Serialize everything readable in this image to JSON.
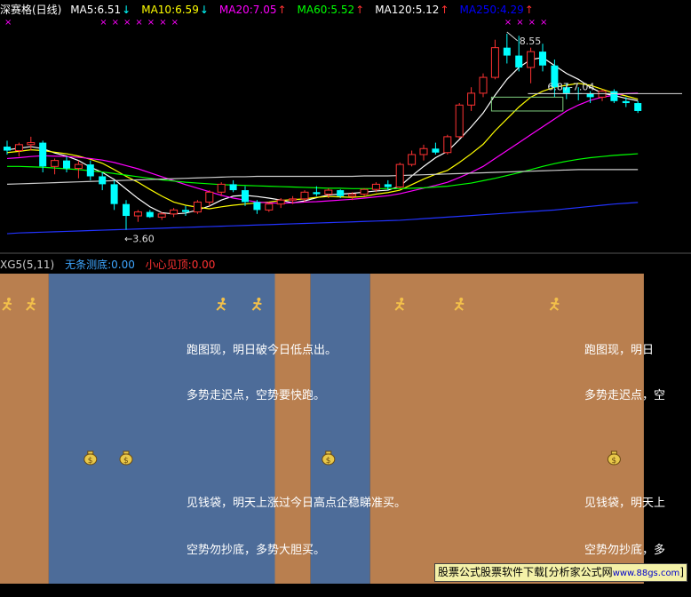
{
  "header": {
    "title": "深赛格(日线)",
    "ma": [
      {
        "label": "MA5:6.51",
        "arrow": "↓",
        "color": "#ffffff"
      },
      {
        "label": "MA10:6.59",
        "arrow": "↓",
        "color": "#ffff00"
      },
      {
        "label": "MA20:7.05",
        "arrow": "↑",
        "color": "#ff00ff"
      },
      {
        "label": "MA60:5.52",
        "arrow": "↑",
        "color": "#00ff00"
      },
      {
        "label": "MA120:5.12",
        "arrow": "↑",
        "color": "#ffffff"
      },
      {
        "label": "MA250:4.29",
        "arrow": "↑",
        "color": "#0000ff"
      }
    ]
  },
  "sub_header": {
    "name": "XG5(5,11)",
    "item1": "无条测底:0.00",
    "item2": "小心见顶:0.00"
  },
  "colors": {
    "up": "#ff3232",
    "down": "#00ffff",
    "orange_bg": "#b97f4f",
    "blue_bg": "#4d6c99",
    "marker": "#ff00ff",
    "runner": "#f3c04a"
  },
  "signal_texts": {
    "run": "跑图现，明日破今日低点出。",
    "run_short": "跑图现，明日",
    "multi_late": "多势走迟点，空势要快跑。",
    "multi_late_short": "多势走迟点，空",
    "money": "见钱袋，明天上涨过今日高点企稳睇准买。",
    "money_short": "见钱袋，明天上",
    "empty_bottom": "空势勿抄底，多势大胆买。",
    "empty_bottom_short": "空势勿抄底，多"
  },
  "watermark": {
    "text": "股票公式股票软件下载[分析家公式网",
    "url": "www.88gs.com",
    "end": "]"
  },
  "chart_data": {
    "type": "candlestick",
    "ylim": [
      3.3,
      9.0
    ],
    "annotations": [
      {
        "text": "8.55",
        "bar": 42,
        "price": 8.55
      },
      {
        "text": "3.60",
        "bar": 10,
        "price": 3.6
      },
      {
        "text": "6.87-7.04",
        "bar": 46,
        "price": 7.04
      }
    ],
    "candles": [
      [
        5.7,
        5.85,
        5.5,
        5.6
      ],
      [
        5.6,
        5.8,
        5.45,
        5.75
      ],
      [
        5.75,
        5.95,
        5.6,
        5.8
      ],
      [
        5.8,
        5.85,
        5.05,
        5.2
      ],
      [
        5.2,
        5.4,
        5.0,
        5.35
      ],
      [
        5.35,
        5.45,
        5.05,
        5.15
      ],
      [
        5.15,
        5.35,
        4.9,
        5.25
      ],
      [
        5.25,
        5.35,
        4.85,
        4.95
      ],
      [
        4.95,
        5.05,
        4.6,
        4.75
      ],
      [
        4.75,
        4.85,
        4.1,
        4.25
      ],
      [
        4.25,
        4.35,
        3.6,
        3.95
      ],
      [
        3.95,
        4.1,
        3.8,
        4.05
      ],
      [
        4.05,
        4.1,
        3.9,
        3.92
      ],
      [
        3.92,
        4.05,
        3.85,
        4.0
      ],
      [
        4.0,
        4.15,
        3.92,
        4.1
      ],
      [
        4.1,
        4.2,
        3.95,
        4.05
      ],
      [
        4.05,
        4.35,
        4.0,
        4.3
      ],
      [
        4.3,
        4.6,
        4.2,
        4.55
      ],
      [
        4.55,
        4.8,
        4.45,
        4.75
      ],
      [
        4.75,
        4.85,
        4.55,
        4.6
      ],
      [
        4.6,
        4.7,
        4.2,
        4.3
      ],
      [
        4.3,
        4.35,
        4.0,
        4.1
      ],
      [
        4.1,
        4.3,
        4.05,
        4.25
      ],
      [
        4.25,
        4.4,
        4.15,
        4.35
      ],
      [
        4.35,
        4.45,
        4.25,
        4.38
      ],
      [
        4.38,
        4.6,
        4.3,
        4.55
      ],
      [
        4.55,
        4.7,
        4.45,
        4.5
      ],
      [
        4.5,
        4.65,
        4.4,
        4.6
      ],
      [
        4.6,
        4.62,
        4.4,
        4.45
      ],
      [
        4.45,
        4.55,
        4.35,
        4.5
      ],
      [
        4.5,
        4.65,
        4.45,
        4.62
      ],
      [
        4.62,
        4.8,
        4.55,
        4.75
      ],
      [
        4.75,
        4.85,
        4.6,
        4.68
      ],
      [
        4.68,
        5.3,
        4.65,
        5.25
      ],
      [
        5.25,
        5.6,
        5.2,
        5.5
      ],
      [
        5.5,
        5.75,
        5.35,
        5.65
      ],
      [
        5.65,
        5.8,
        5.5,
        5.55
      ],
      [
        5.55,
        6.0,
        5.5,
        5.95
      ],
      [
        5.95,
        6.8,
        5.9,
        6.75
      ],
      [
        6.75,
        7.2,
        6.6,
        7.05
      ],
      [
        7.05,
        7.55,
        6.95,
        7.45
      ],
      [
        7.45,
        8.4,
        7.4,
        8.2
      ],
      [
        8.2,
        8.55,
        7.8,
        8.0
      ],
      [
        8.0,
        8.5,
        7.6,
        7.7
      ],
      [
        7.7,
        8.2,
        7.3,
        8.1
      ],
      [
        8.1,
        8.3,
        7.6,
        7.75
      ],
      [
        7.75,
        7.9,
        6.95,
        7.2
      ],
      [
        7.2,
        7.3,
        6.9,
        7.05
      ],
      [
        7.05,
        7.2,
        6.87,
        7.04
      ],
      [
        7.04,
        7.1,
        6.8,
        6.95
      ],
      [
        6.95,
        7.15,
        6.85,
        7.1
      ],
      [
        7.1,
        7.15,
        6.8,
        6.85
      ],
      [
        6.85,
        6.95,
        6.7,
        6.8
      ],
      [
        6.8,
        6.85,
        6.55,
        6.6
      ]
    ],
    "ma_series": [
      {
        "name": "MA5",
        "color": "#ffffff",
        "values": [
          5.62,
          5.66,
          5.7,
          5.65,
          5.54,
          5.46,
          5.35,
          5.18,
          5.05,
          4.87,
          4.63,
          4.39,
          4.18,
          4.03,
          4.0,
          4.02,
          4.1,
          4.2,
          4.35,
          4.45,
          4.47,
          4.44,
          4.4,
          4.35,
          4.28,
          4.33,
          4.41,
          4.48,
          4.5,
          4.52,
          4.55,
          4.58,
          4.6,
          4.7,
          4.96,
          5.2,
          5.42,
          5.58,
          5.88,
          6.2,
          6.55,
          7.0,
          7.4,
          7.7,
          7.9,
          7.95,
          7.75,
          7.55,
          7.4,
          7.2,
          7.05,
          6.99,
          6.92,
          6.86
        ]
      },
      {
        "name": "MA10",
        "color": "#ffff00",
        "values": [
          5.55,
          5.58,
          5.62,
          5.6,
          5.56,
          5.52,
          5.46,
          5.38,
          5.28,
          5.12,
          4.95,
          4.8,
          4.62,
          4.45,
          4.3,
          4.22,
          4.17,
          4.13,
          4.18,
          4.22,
          4.25,
          4.28,
          4.3,
          4.34,
          4.36,
          4.38,
          4.42,
          4.44,
          4.43,
          4.42,
          4.44,
          4.5,
          4.54,
          4.6,
          4.74,
          4.88,
          5.0,
          5.1,
          5.3,
          5.52,
          5.76,
          6.1,
          6.4,
          6.7,
          6.95,
          7.1,
          7.2,
          7.25,
          7.3,
          7.25,
          7.15,
          7.05,
          6.98,
          6.9
        ]
      },
      {
        "name": "MA20",
        "color": "#ff00ff",
        "values": [
          5.4,
          5.42,
          5.45,
          5.47,
          5.46,
          5.45,
          5.43,
          5.4,
          5.36,
          5.3,
          5.22,
          5.14,
          5.04,
          4.94,
          4.84,
          4.74,
          4.65,
          4.56,
          4.47,
          4.4,
          4.35,
          4.3,
          4.28,
          4.27,
          4.28,
          4.3,
          4.31,
          4.33,
          4.35,
          4.37,
          4.4,
          4.43,
          4.46,
          4.51,
          4.58,
          4.65,
          4.72,
          4.8,
          4.92,
          5.05,
          5.2,
          5.4,
          5.6,
          5.8,
          6.0,
          6.2,
          6.4,
          6.6,
          6.75,
          6.87,
          6.95,
          7.0,
          7.04,
          7.05
        ]
      },
      {
        "name": "MA60",
        "color": "#00ff00",
        "values": [
          5.2,
          5.2,
          5.19,
          5.18,
          5.16,
          5.14,
          5.12,
          5.09,
          5.06,
          5.02,
          4.98,
          4.94,
          4.9,
          4.86,
          4.83,
          4.8,
          4.78,
          4.76,
          4.74,
          4.73,
          4.72,
          4.71,
          4.7,
          4.69,
          4.68,
          4.67,
          4.66,
          4.65,
          4.65,
          4.64,
          4.64,
          4.64,
          4.64,
          4.64,
          4.65,
          4.66,
          4.68,
          4.7,
          4.74,
          4.78,
          4.84,
          4.9,
          4.97,
          5.04,
          5.12,
          5.2,
          5.27,
          5.33,
          5.38,
          5.42,
          5.45,
          5.48,
          5.5,
          5.52
        ]
      },
      {
        "name": "MA120",
        "color": "#cccccc",
        "values": [
          4.75,
          4.76,
          4.77,
          4.78,
          4.79,
          4.8,
          4.81,
          4.82,
          4.83,
          4.84,
          4.85,
          4.86,
          4.87,
          4.88,
          4.89,
          4.9,
          4.91,
          4.92,
          4.93,
          4.94,
          4.94,
          4.95,
          4.95,
          4.95,
          4.95,
          4.95,
          4.95,
          4.95,
          4.95,
          4.95,
          4.96,
          4.96,
          4.96,
          4.97,
          4.98,
          4.99,
          5.0,
          5.01,
          5.02,
          5.03,
          5.04,
          5.05,
          5.06,
          5.07,
          5.08,
          5.09,
          5.1,
          5.11,
          5.12,
          5.12,
          5.12,
          5.12,
          5.12,
          5.12
        ]
      },
      {
        "name": "MA250",
        "color": "#2233ff",
        "values": [
          3.5,
          3.52,
          3.53,
          3.54,
          3.55,
          3.56,
          3.57,
          3.58,
          3.59,
          3.6,
          3.61,
          3.62,
          3.63,
          3.64,
          3.65,
          3.66,
          3.67,
          3.68,
          3.69,
          3.7,
          3.71,
          3.72,
          3.73,
          3.74,
          3.75,
          3.76,
          3.77,
          3.78,
          3.79,
          3.8,
          3.81,
          3.82,
          3.83,
          3.84,
          3.86,
          3.88,
          3.9,
          3.92,
          3.94,
          3.96,
          3.98,
          4.0,
          4.02,
          4.04,
          4.06,
          4.08,
          4.1,
          4.13,
          4.16,
          4.19,
          4.22,
          4.25,
          4.27,
          4.29
        ]
      }
    ],
    "bands": [
      {
        "kind": "orange",
        "from": 0,
        "to": 3
      },
      {
        "kind": "blue",
        "from": 4,
        "to": 22
      },
      {
        "kind": "orange",
        "from": 23,
        "to": 25
      },
      {
        "kind": "blue",
        "from": 26,
        "to": 30
      },
      {
        "kind": "orange",
        "from": 31,
        "to": 53
      }
    ],
    "run_markers": [
      0,
      2,
      18,
      21,
      33,
      38,
      46
    ],
    "money_markers": [
      7,
      10,
      27,
      51
    ],
    "top_markers": [
      0,
      8,
      9,
      10,
      11,
      12,
      13,
      14,
      42,
      43,
      44,
      45
    ],
    "text_rows": [
      {
        "key": "run",
        "offset": 87
      },
      {
        "key": "multi_late",
        "offset": 138
      },
      {
        "key": "money",
        "offset": 259
      },
      {
        "key": "empty_bottom",
        "offset": 312
      }
    ],
    "text_positions": [
      210,
      658
    ]
  }
}
